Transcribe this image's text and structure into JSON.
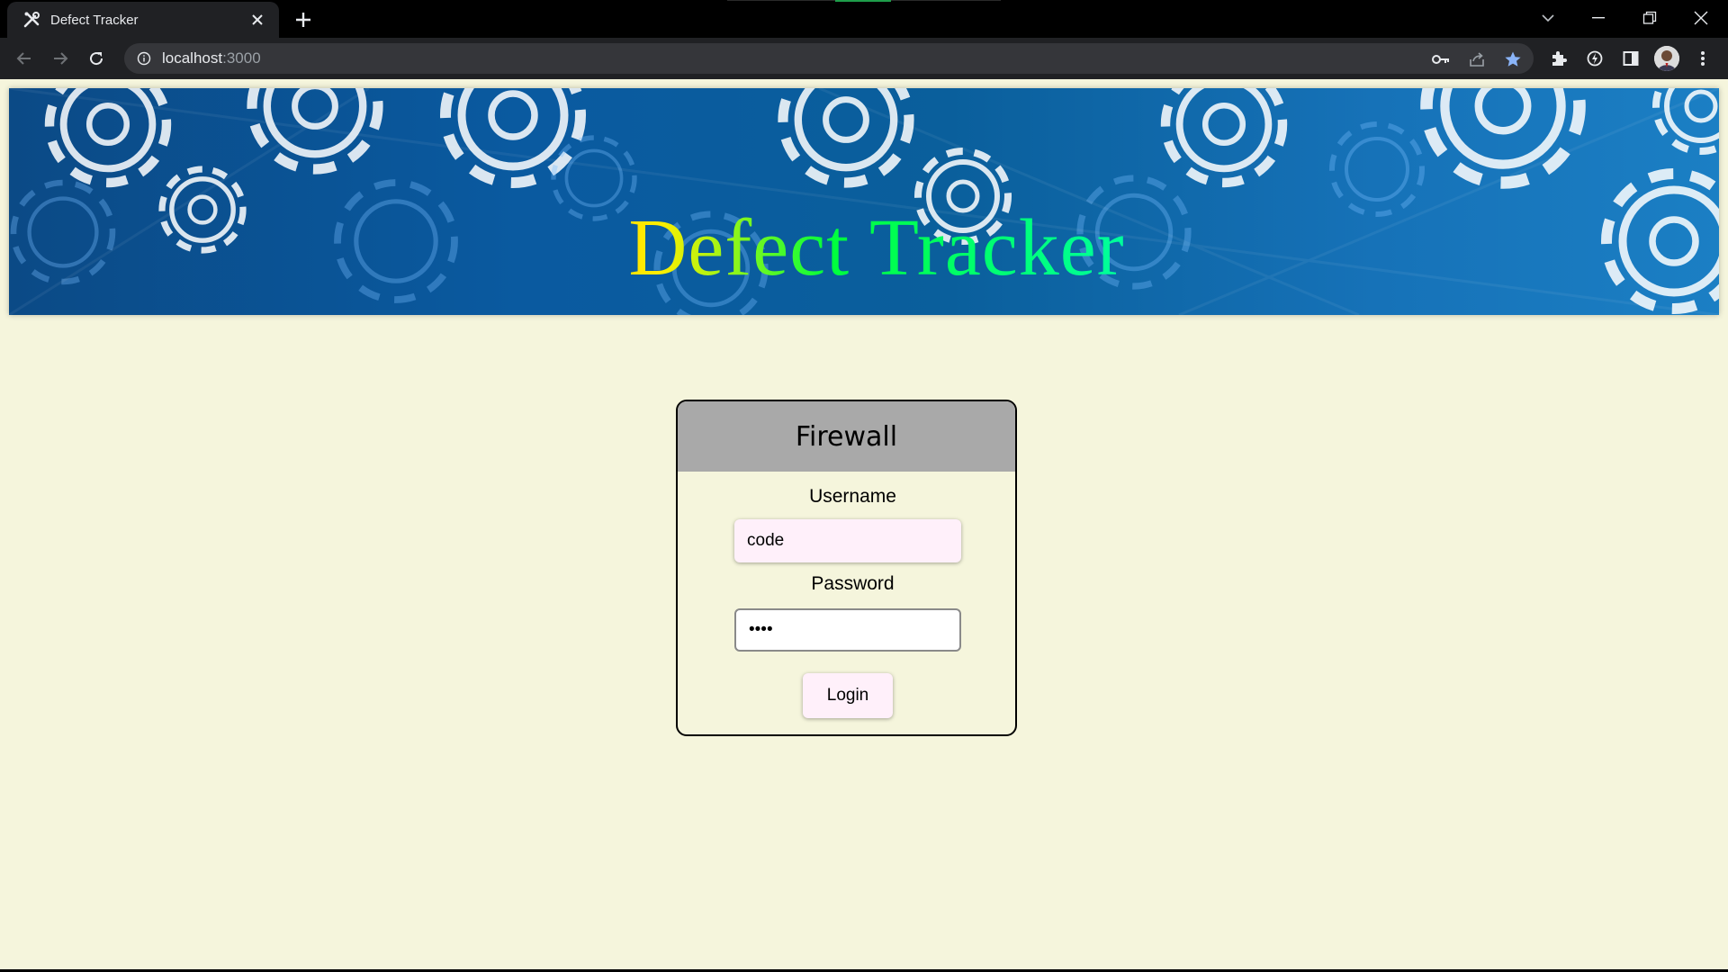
{
  "browser": {
    "tab_title": "Defect Tracker",
    "url_host": "localhost",
    "url_port": ":3000",
    "icons": {
      "favicon": "tools-icon",
      "close": "close-icon",
      "new_tab": "plus-icon",
      "back": "arrow-left-icon",
      "forward": "arrow-right-icon",
      "reload": "reload-icon",
      "info": "info-icon",
      "password": "key-icon",
      "share": "share-icon",
      "bookmark": "star-icon",
      "extensions": "puzzle-icon",
      "performance": "speed-icon",
      "side_panel": "side-panel-icon",
      "menu": "kebab-menu-icon"
    },
    "bookmark_color": "#8ab4f8"
  },
  "banner": {
    "title_word1": "Defect",
    "title_word2": "Tracker"
  },
  "login": {
    "title": "Firewall",
    "username_label": "Username",
    "username_value": "code",
    "password_label": "Password",
    "password_value": "••••",
    "button_label": "Login"
  }
}
